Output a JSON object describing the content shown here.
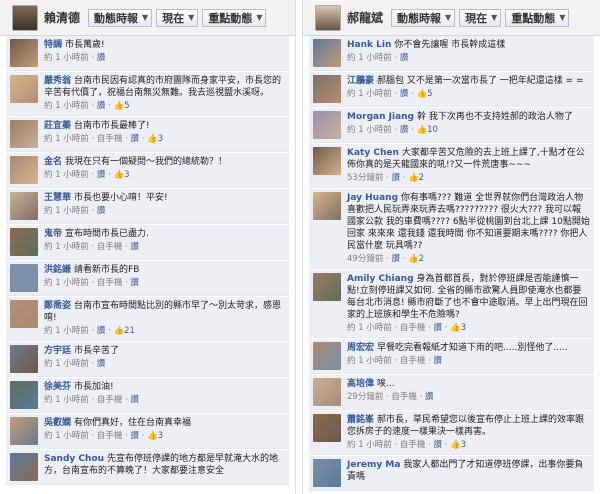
{
  "left": {
    "header": {
      "name": "賴清德",
      "buttons": [
        "動態時報",
        "現在",
        "重點動態"
      ]
    },
    "comments": [
      {
        "name": "特調",
        "text": "市長萬歲!",
        "time": "約 1 小時前",
        "like": "讚",
        "count": ""
      },
      {
        "name": "嚴秀翁",
        "text": "台南市民因有認真的市府團隊而身家平安，市長您的辛苦有代價了，祝福台南無災無難。我去巡視鹽水溪呀。",
        "time": "約 1 小時前",
        "like": "讚",
        "count": "5"
      },
      {
        "name": "莊宜蓁",
        "text": "台南市市長最棒了!",
        "time": "約 1 小時前 · 自手機",
        "like": "讚",
        "count": "3"
      },
      {
        "name": "金名",
        "text": "我現在只有一個疑問～我們的總統勒？！",
        "time": "約 1 小時前",
        "like": "讚",
        "count": "3"
      },
      {
        "name": "王慧華",
        "text": "市長也要小心唷！平安!",
        "time": "約 1 小時前",
        "like": "讚",
        "count": ""
      },
      {
        "name": "鬼帝",
        "text": "宣布時間市長已盡力.",
        "time": "約 1 小時前 · 自手機",
        "like": "讚",
        "count": ""
      },
      {
        "name": "洪銘謙",
        "text": "請看新市長的FB",
        "time": "約 1 小時前 · 自手機",
        "like": "讚",
        "count": ""
      },
      {
        "name": "鄭喬姿",
        "text": "台南市宣布時間點比別的縣市早了～別太苛求，感恩唷!",
        "time": "約 1 小時前",
        "like": "讚",
        "count": "21"
      },
      {
        "name": "方宇廷",
        "text": "市長辛苦了",
        "time": "約 1 小時前",
        "like": "讚",
        "count": ""
      },
      {
        "name": "徐美芬",
        "text": "市長加油!",
        "time": "約 1 小時前 · 自手機",
        "like": "讚",
        "count": ""
      },
      {
        "name": "吳叡嫻",
        "text": "有你們真好，住在台南真幸福",
        "time": "約 1 小時前 · 自手機",
        "like": "讚",
        "count": "3"
      },
      {
        "name": "Sandy Chou",
        "text": "先宣布停班停課的地方都是早就淹大水的地方，台南宣布的不算晚了！大家都要注意安全",
        "time": "",
        "like": "",
        "count": ""
      }
    ]
  },
  "right": {
    "header": {
      "name": "郝龍斌",
      "buttons": [
        "動態時報",
        "現在",
        "重點動態"
      ]
    },
    "comments": [
      {
        "name": "Hank Lin",
        "text": "你不會先讓喔 市長幹成這樣",
        "time": "約 1 小時前",
        "like": "讚",
        "count": ""
      },
      {
        "name": "江鵬豪",
        "text": "郝腦包 又不是第一次當市長了 一把年紀還這樣 = =",
        "time": "約 1 小時前",
        "like": "讚",
        "count": "5"
      },
      {
        "name": "Morgan Jiang",
        "text": "幹 我下次再也不支持姓郝的政治人物了",
        "time": "約 1 小時前",
        "like": "讚",
        "count": "10"
      },
      {
        "name": "Katy Chen",
        "text": "大家都辛苦又危險的去上班上課了,十點才在公佈你真的是天龍國來的吼!?又一件荒唐事~~~",
        "time": "53分鐘前",
        "like": "讚",
        "count": "2"
      },
      {
        "name": "Jay Huang",
        "text": "你有事嗎??? 難道 全世界就你們台灣政治人物喜歡把人民玩弄來玩弄去嗎????????? 很火大??? 我可以報國家公款 我的車費嗎???? 6點半從桃園到台北上課 10點開始回家 來來來 還我錢 還我時間 你不知道要期末嗎???? 你把人民當什麼 玩具嗎??",
        "time": "49分鐘前",
        "like": "讚",
        "count": "2"
      },
      {
        "name": "Amily Chiang",
        "text": "身為首都首長，對於停班課是否能謹慎一點!立刻停班課又如何. 全省的縣市欲驚人員即使淹水也都要每台北市消息! 縣市府斷了也不會中途取消。早上出門現在回家的上班族和學生不危險嗎?",
        "time": "約 1 小時前 · 自手機",
        "like": "讚",
        "count": "3"
      },
      {
        "name": "周宏宏",
        "text": "早餐吃完看報紙才知道下雨的吧.....別怪他了.....",
        "time": "約 1 小時前 · 自手機",
        "like": "讚",
        "count": ""
      },
      {
        "name": "高培偉",
        "text": "唉...",
        "time": "29分鐘前 · 自手機",
        "like": "讚",
        "count": ""
      },
      {
        "name": "蕭銘峯",
        "text": "郝市長，草民希望您以後宣布停止上班上課的效率跟您拆房子的速度一樣果決一樣再害。",
        "time": "約 1 小時前 · 自手機",
        "like": "讚",
        "count": "3"
      },
      {
        "name": "Jeremy Ma",
        "text": "我家人都出門了才知道停班停課，出事你要負責嗎",
        "time": "",
        "like": "",
        "count": ""
      }
    ]
  },
  "colors": {
    "name": "#3b5998",
    "meta": "#808080",
    "bg": "#edeff4"
  },
  "icons": {
    "chevron": "chevron-down-icon",
    "like": "thumbs-up-icon"
  }
}
